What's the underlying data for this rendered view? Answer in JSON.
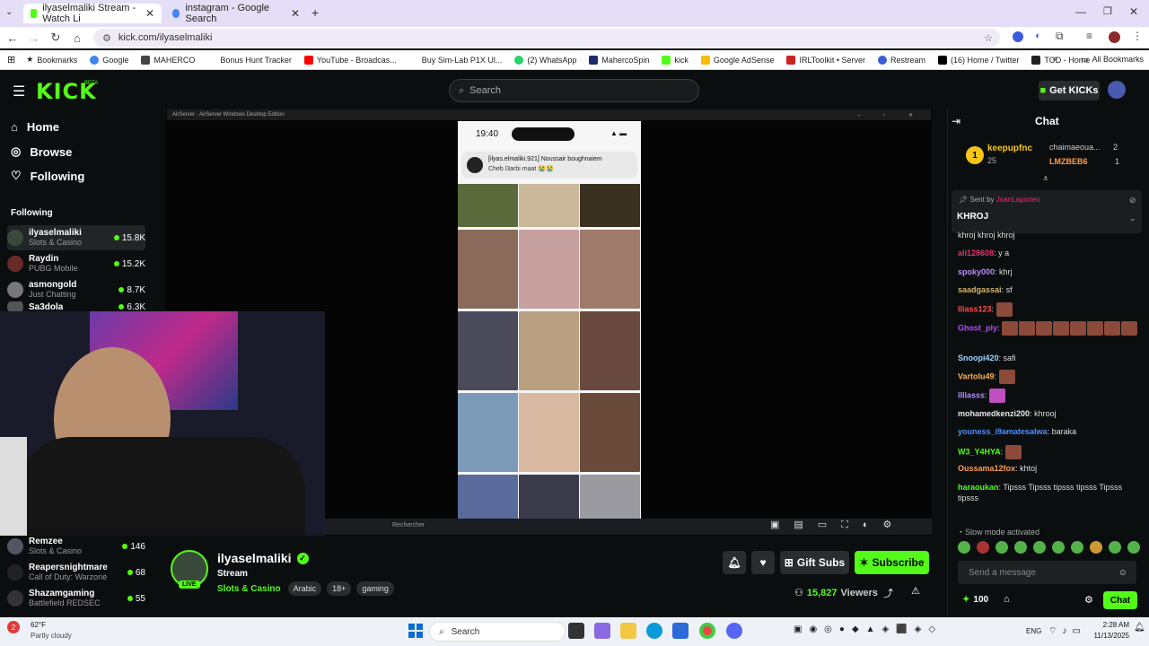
{
  "browser": {
    "tabs": [
      {
        "title": "ilyaselmaliki Stream - Watch Li",
        "active": true
      },
      {
        "title": "instagram - Google Search",
        "active": false
      }
    ],
    "url": "kick.com/ilyaselmaliki",
    "bookmarks": [
      "Bookmarks",
      "Google",
      "MAHERCO",
      "Bonus Hunt Tracker",
      "YouTube - Broadcas...",
      "Buy Sim-Lab P1X Ul...",
      "(2) WhatsApp",
      "MahercoSpin",
      "kick",
      "Google AdSense",
      "IRLToolkit • Server",
      "Restream",
      "(16) Home / Twitter",
      "TOD - Home"
    ],
    "all_bookmarks": "All Bookmarks"
  },
  "kick": {
    "logo": "KICK",
    "beta": "BETA",
    "search_placeholder": "Search",
    "get_kicks": "Get KICKs"
  },
  "sidebar": {
    "nav": [
      "Home",
      "Browse",
      "Following"
    ],
    "following_header": "Following",
    "following": [
      {
        "name": "ilyaselmaliki",
        "category": "Slots & Casino",
        "viewers": "15.8K"
      },
      {
        "name": "Raydin",
        "category": "PUBG Mobile",
        "viewers": "15.2K"
      },
      {
        "name": "asmongold",
        "category": "Just Chatting",
        "viewers": "8.7K"
      },
      {
        "name": "Sa3dola",
        "category": "",
        "viewers": "6.3K"
      }
    ],
    "more": [
      {
        "name": "Remzee",
        "category": "Slots & Casino",
        "viewers": "146"
      },
      {
        "name": "Reapersnightmare",
        "category": "Call of Duty: Warzone",
        "viewers": "68"
      },
      {
        "name": "Shazamgaming",
        "category": "Battlefield REDSEC",
        "viewers": "55"
      }
    ]
  },
  "stream": {
    "airserver_title": "AirServer - AirServer Windows Desktop Edition",
    "phone_time": "19:40",
    "phone_notification_user": "[ilyas.elmaliki.921] Noussair boughnaiem",
    "phone_notification_msg": "Cheb l3arbi maat 😭😭",
    "taskbar_search": "Rechercher"
  },
  "channel": {
    "name": "ilyaselmaliki",
    "title": "Stream",
    "category": "Slots & Casino",
    "tags": [
      "Arabic",
      "18+",
      "gaming"
    ],
    "live": "LIVE",
    "viewers": "15,827",
    "viewers_label": "Viewers",
    "gift_subs": "Gift Subs",
    "subscribe": "Subscribe"
  },
  "chat": {
    "title": "Chat",
    "top_gifters": [
      {
        "name": "keepupfnc",
        "count": "25"
      },
      {
        "name": "chaimaeoua...",
        "count": "2"
      },
      {
        "name": "LMZBEB6",
        "count": "1"
      }
    ],
    "pinned_sent_by": "Sent by",
    "pinned_sender": "JoanLaporteo",
    "pinned_message": "KHROJ",
    "messages": [
      {
        "user": "",
        "text": "khroj khroj khroj",
        "color": "#ddd"
      },
      {
        "user": "ali128608",
        "text": "y a",
        "color": "#e03070"
      },
      {
        "user": "spoky000",
        "text": "khrj",
        "color": "#b78cff"
      },
      {
        "user": "saadgassai",
        "text": "sf",
        "color": "#d8b66a"
      },
      {
        "user": "lliass123",
        "text": "",
        "color": "#ff4d4d"
      },
      {
        "user": "Ghost_ply",
        "text": "",
        "color": "#b04dff"
      },
      {
        "user": "Snoopi420",
        "text": "safi",
        "color": "#9ad8ff"
      },
      {
        "user": "Vartolu49",
        "text": "",
        "color": "#ffb14d"
      },
      {
        "user": "illiasss",
        "text": "",
        "color": "#b78cff"
      },
      {
        "user": "mohamedkenzi200",
        "text": "khrooj",
        "color": "#e8e8e8"
      },
      {
        "user": "youness_i9amatesalwa",
        "text": "baraka",
        "color": "#4d8dff"
      },
      {
        "user": "W3_Y4HYA",
        "text": "",
        "color": "#53fc18"
      },
      {
        "user": "Oussama12fox",
        "text": "khtoj",
        "color": "#ff9d4d"
      },
      {
        "user": "haraoukan",
        "text": "Tipsss Tipsss tipsss tipsss Tipsss tipsss",
        "color": "#53fc18"
      }
    ],
    "slow_mode": "Slow mode activated",
    "input_placeholder": "Send a message",
    "points": "100",
    "send": "Chat"
  },
  "windows": {
    "weather_temp": "62°F",
    "weather_desc": "Partly cloudy",
    "weather_badge": "2",
    "search": "Search",
    "lang": "ENG",
    "time": "2:28 AM",
    "date": "11/13/2025"
  }
}
